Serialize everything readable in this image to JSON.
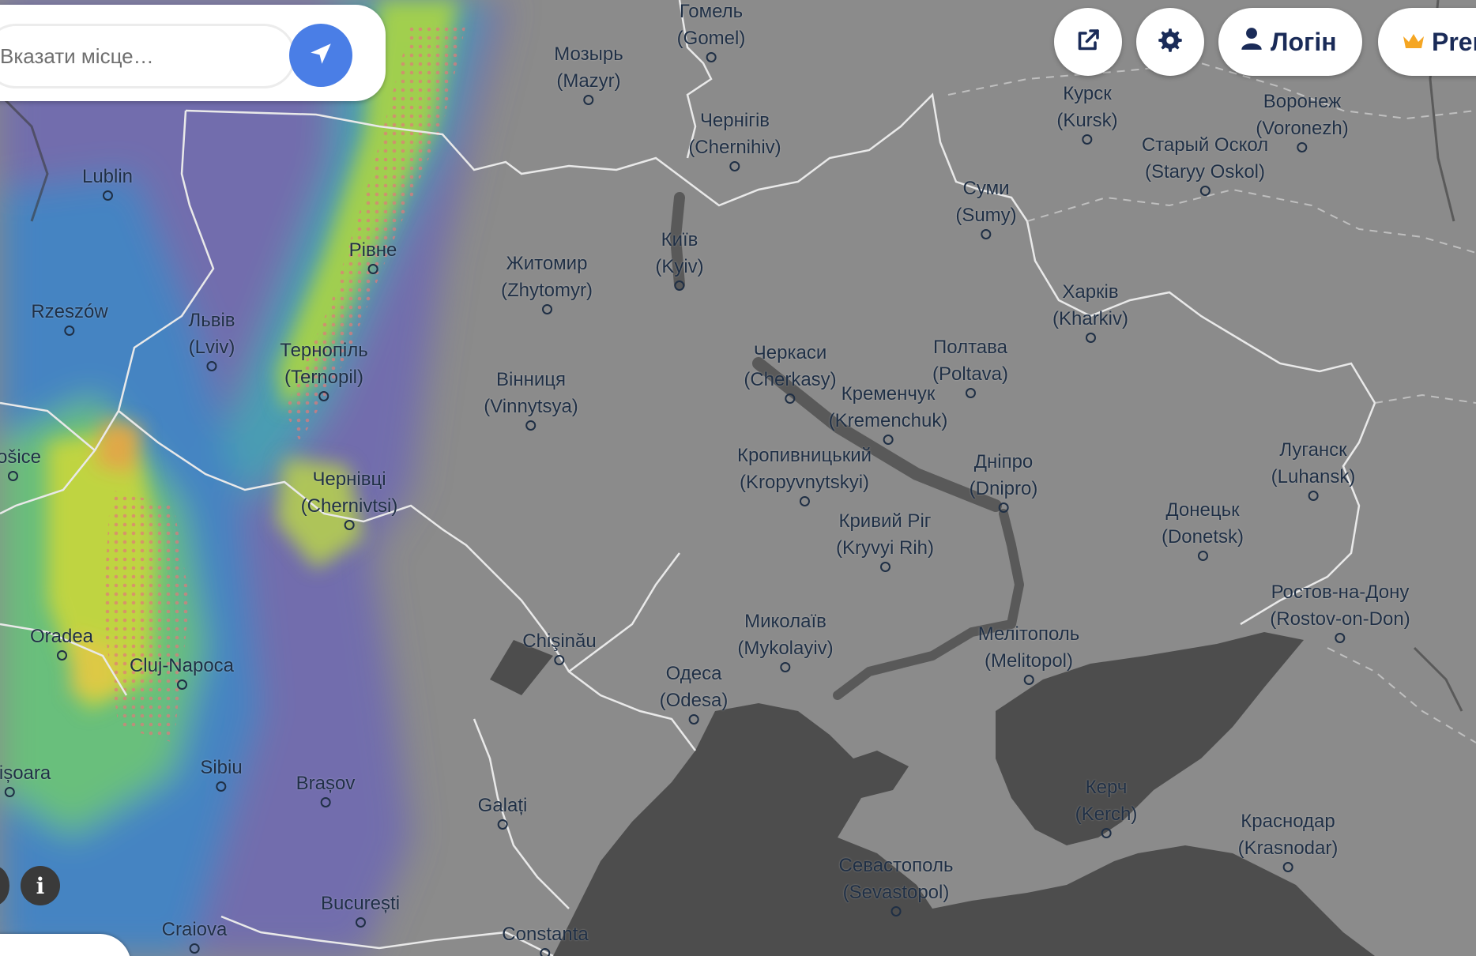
{
  "search": {
    "placeholder": "Вказати місце…"
  },
  "toolbar": {
    "login_label": "Логін",
    "premium_label": "Premium"
  },
  "colors": {
    "land": "#8c8c8c",
    "sea": "#4d4d4d",
    "border": "#e6e6e6",
    "label": "#1f2f45",
    "accent": "#4a7ee6",
    "button_text": "#1a2b58",
    "crown": "#f5a623"
  },
  "icons": [
    "location-arrow-icon",
    "external-link-icon",
    "gear-icon",
    "user-icon",
    "crown-icon",
    "info-icon"
  ],
  "cities": [
    {
      "id": "gomel",
      "name": "Гомель",
      "latin": "(Gomel)"
    },
    {
      "id": "mazyr",
      "name": "Мозырь",
      "latin": "(Mazyr)"
    },
    {
      "id": "chernihiv",
      "name": "Чернігів",
      "latin": "(Chernihiv)"
    },
    {
      "id": "kursk",
      "name": "Курск",
      "latin": "(Kursk)"
    },
    {
      "id": "voronezh",
      "name": "Воронеж",
      "latin": "(Voronezh)"
    },
    {
      "id": "staryy-oskol",
      "name": "Старый Оскол",
      "latin": "(Staryy Oskol)"
    },
    {
      "id": "sumy",
      "name": "Суми",
      "latin": "(Sumy)"
    },
    {
      "id": "lublin",
      "name": "Lublin",
      "latin": ""
    },
    {
      "id": "rivne",
      "name": "Рівне",
      "latin": ""
    },
    {
      "id": "zhytomyr",
      "name": "Житомир",
      "latin": "(Zhytomyr)"
    },
    {
      "id": "kyiv",
      "name": "Київ",
      "latin": "(Kyiv)"
    },
    {
      "id": "kharkiv",
      "name": "Харків",
      "latin": "(Kharkiv)"
    },
    {
      "id": "rzeszow",
      "name": "Rzeszów",
      "latin": ""
    },
    {
      "id": "lviv",
      "name": "Львів",
      "latin": "(Lviv)"
    },
    {
      "id": "ternopil",
      "name": "Тернопіль",
      "latin": "(Ternopil)"
    },
    {
      "id": "poltava",
      "name": "Полтава",
      "latin": "(Poltava)"
    },
    {
      "id": "vinnytsya",
      "name": "Вінниця",
      "latin": "(Vinnytsya)"
    },
    {
      "id": "cherkasy",
      "name": "Черкаси",
      "latin": "(Cherkasy)"
    },
    {
      "id": "kremenchuk",
      "name": "Кременчук",
      "latin": "(Kremenchuk)"
    },
    {
      "id": "luhansk",
      "name": "Луганск",
      "latin": "(Luhansk)"
    },
    {
      "id": "kosice",
      "name": "Košice",
      "latin": ""
    },
    {
      "id": "kropyvnytskyi",
      "name": "Кропивницький",
      "latin": "(Kropyvnytskyi)"
    },
    {
      "id": "dnipro",
      "name": "Дніпро",
      "latin": "(Dnipro)"
    },
    {
      "id": "chernivtsi",
      "name": "Чернівці",
      "latin": "(Chernivtsi)"
    },
    {
      "id": "donetsk",
      "name": "Донецьк",
      "latin": "(Donetsk)"
    },
    {
      "id": "kryvyi-rih",
      "name": "Кривий Ріг",
      "latin": "(Kryvyi Rih)"
    },
    {
      "id": "rostov",
      "name": "Ростов-на-Дону",
      "latin": "(Rostov-on-Don)"
    },
    {
      "id": "mykolayiv",
      "name": "Миколаїв",
      "latin": "(Mykolayiv)"
    },
    {
      "id": "melitopol",
      "name": "Мелітополь",
      "latin": "(Melitopol)"
    },
    {
      "id": "oradea",
      "name": "Oradea",
      "latin": ""
    },
    {
      "id": "chisinau",
      "name": "Chişinău",
      "latin": ""
    },
    {
      "id": "cluj",
      "name": "Cluj-Napoca",
      "latin": ""
    },
    {
      "id": "odesa",
      "name": "Одеса",
      "latin": "(Odesa)"
    },
    {
      "id": "timisoara",
      "name": "Timișoara",
      "latin": ""
    },
    {
      "id": "sibiu",
      "name": "Sibiu",
      "latin": ""
    },
    {
      "id": "brasov",
      "name": "Brașov",
      "latin": ""
    },
    {
      "id": "kerch",
      "name": "Керч",
      "latin": "(Kerch)"
    },
    {
      "id": "krasnodar",
      "name": "Краснодар",
      "latin": "(Krasnodar)"
    },
    {
      "id": "galati",
      "name": "Galați",
      "latin": ""
    },
    {
      "id": "sevastopol",
      "name": "Севастополь",
      "latin": "(Sevastopol)"
    },
    {
      "id": "bucuresti",
      "name": "București",
      "latin": ""
    },
    {
      "id": "craiova",
      "name": "Craiova",
      "latin": ""
    },
    {
      "id": "constanta",
      "name": "Constanta",
      "latin": ""
    }
  ]
}
